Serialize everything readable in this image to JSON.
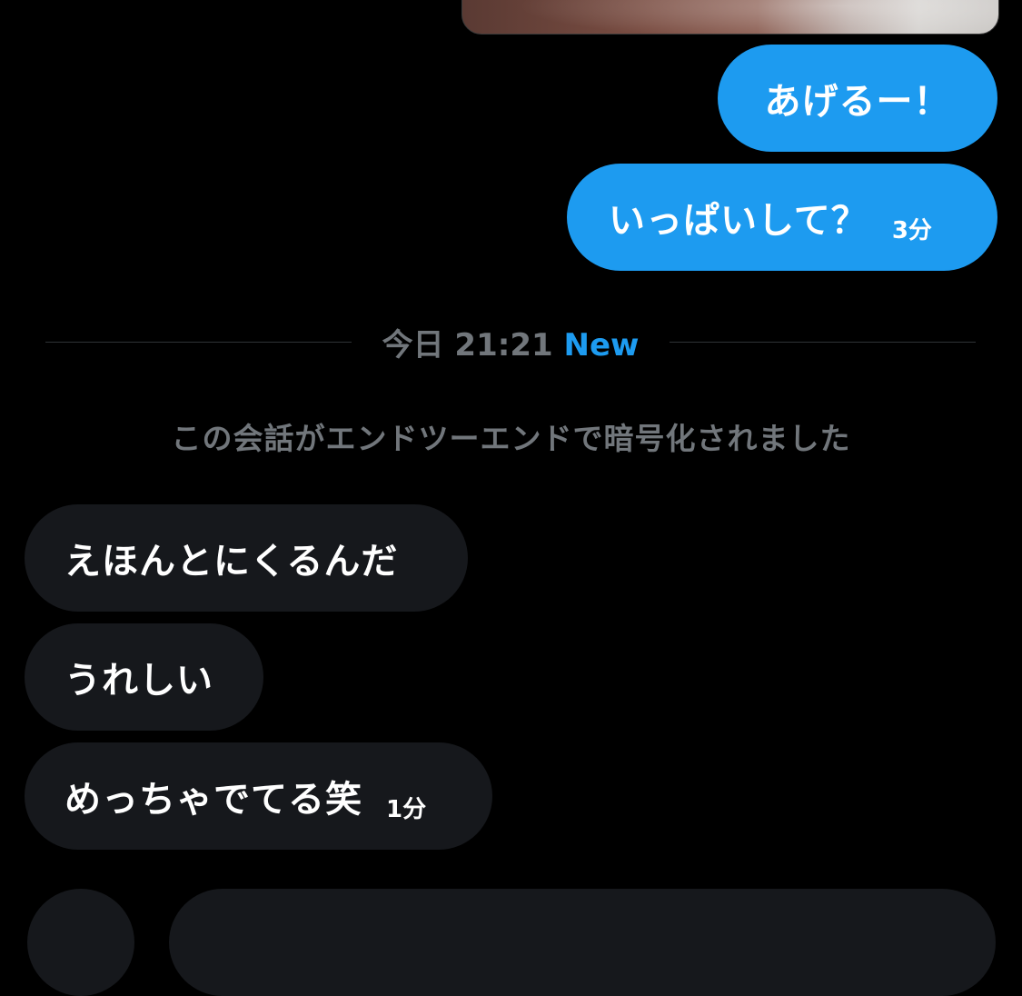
{
  "conversation": {
    "outgoing": [
      {
        "text": "あげるー！",
        "time": ""
      },
      {
        "text": "いっぱいして？",
        "time": "3分"
      }
    ],
    "divider": {
      "date": "今日 21:21",
      "new_label": "New"
    },
    "encryption_notice": "この会話がエンドツーエンドで暗号化されました",
    "incoming": [
      {
        "text": "えほんとにくるんだ",
        "time": ""
      },
      {
        "text": "うれしい",
        "time": ""
      },
      {
        "text": "めっちゃでてる笑",
        "time": "1分"
      }
    ]
  },
  "colors": {
    "background": "#000000",
    "outgoing_bubble": "#1d9bf0",
    "incoming_bubble": "#16181c",
    "muted_text": "#71767b",
    "accent": "#1d9bf0"
  }
}
